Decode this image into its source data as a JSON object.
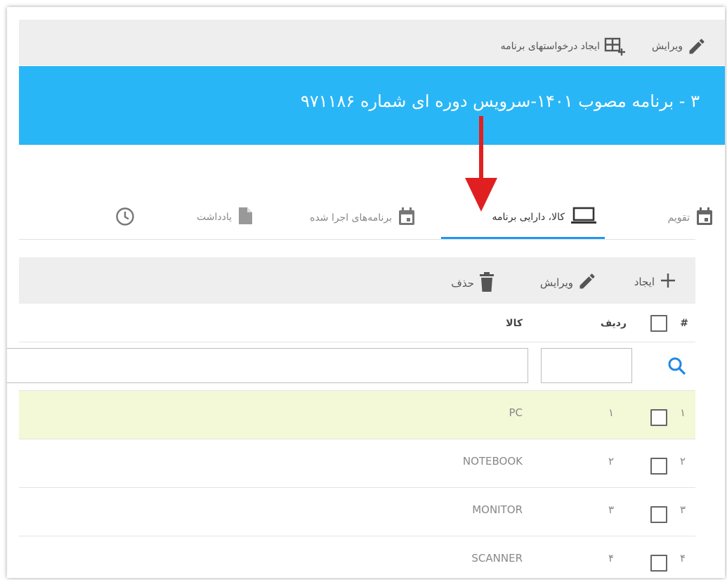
{
  "toolbar": {
    "edit_label": "ویرایش",
    "create_requests_label": "ایجاد درخواستهای برنامه"
  },
  "header": {
    "title": "۳ - برنامه مصوب ۱۴۰۱-سرویس دوره ای شماره ۹۷۱۱۸۶",
    "background_color": "#29b6f6"
  },
  "tabs": [
    {
      "label": "تقویم",
      "icon": "calendar-icon",
      "active": false
    },
    {
      "label": "کالا، دارایی برنامه",
      "icon": "laptop-icon",
      "active": true
    },
    {
      "label": "برنامه‌های اجرا شده",
      "icon": "calendar-icon",
      "active": false
    },
    {
      "label": "یادداشت",
      "icon": "document-icon",
      "active": false
    },
    {
      "label": "",
      "icon": "clock-icon",
      "active": false
    }
  ],
  "actions": {
    "create_label": "ایجاد",
    "edit_label": "ویرایش",
    "delete_label": "حذف"
  },
  "table": {
    "columns": {
      "hash": "#",
      "row": "ردیف",
      "item": "کالا"
    },
    "rows": [
      {
        "index": "۱",
        "row": "۱",
        "item": "PC",
        "highlight": true
      },
      {
        "index": "۲",
        "row": "۲",
        "item": "NOTEBOOK",
        "highlight": false
      },
      {
        "index": "۳",
        "row": "۳",
        "item": "MONITOR",
        "highlight": false
      },
      {
        "index": "۴",
        "row": "۴",
        "item": "SCANNER",
        "highlight": false
      }
    ]
  },
  "colors": {
    "accent": "#2196f3",
    "arrow": "#e02020",
    "highlight_row": "#f3f8d7"
  }
}
